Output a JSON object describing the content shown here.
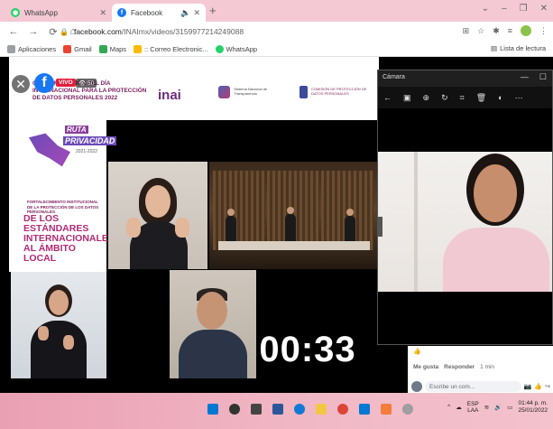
{
  "browser": {
    "tabs": [
      {
        "label": "WhatsApp",
        "color": "#25d366"
      },
      {
        "label": "Facebook",
        "color": "#1877f2",
        "extra": "🔈"
      }
    ],
    "address": {
      "domain": "facebook.com",
      "path": "/INAImx/videos/3159977214249088"
    },
    "bookmarks": [
      {
        "label": "Aplicaciones",
        "color": "#ea4335"
      },
      {
        "label": "Gmail",
        "color": "#ea4335"
      },
      {
        "label": "Maps",
        "color": "#34a853"
      },
      {
        "label": ":: Correo Electronic...",
        "color": "#fbbc05"
      },
      {
        "label": "WhatsApp",
        "color": "#25d366"
      }
    ],
    "reading_list": "Lista de lectura"
  },
  "stream": {
    "banner_title": "CONMEMORACIÓN DEL DÍA INTERNACIONAL PARA LA PROTECCIÓN DE DATOS PERSONALES 2022",
    "logo_inai": "inai",
    "logo_snt_text": "Sistema Nacional de Transparencia",
    "logo_com_text": "COMISIÓN DE PROTECCIÓN DE DATOS PERSONALES",
    "ruta_word1": "RUTA",
    "ruta_word2": "PRIVACIDAD",
    "ruta_year": "2021-2022",
    "fortalecimiento": "FORTALECIMIENTO INSTITUCIONAL DE LA PROTECCIÓN DE LOS DATOS PERSONALES",
    "estandares": "DE LOS ESTÁNDARES INTERNACIONALES AL ÁMBITO LOCAL",
    "live_label": "VIVO",
    "viewers": "50",
    "timer": "00:33"
  },
  "camera": {
    "title": "Cámara",
    "controls": [
      "—",
      "☐"
    ]
  },
  "comments": {
    "like": "Me gusta",
    "reply": "Responder",
    "time": "1 min",
    "placeholder": "Escribe un com..."
  },
  "taskbar": {
    "lang": "ESP",
    "lang2": "LAA",
    "time": "01:44 p. m.",
    "date": "25/01/2022"
  }
}
